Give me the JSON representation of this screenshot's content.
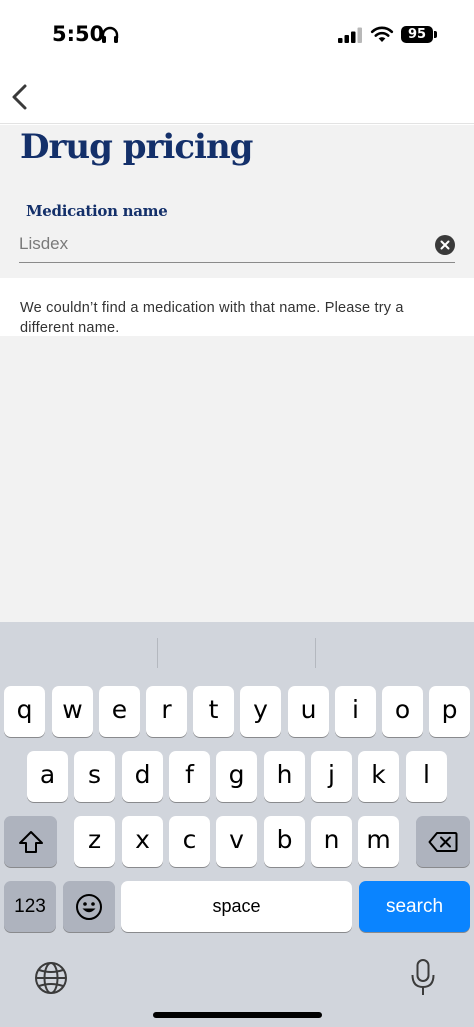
{
  "status_bar": {
    "time": "5:50",
    "battery": "95"
  },
  "nav": {
    "back_icon": "chevron-left-icon"
  },
  "page": {
    "title": "Drug pricing",
    "field_label": "Medication name",
    "field_value": "Lisdex",
    "clear_icon": "clear-icon",
    "message": "We couldn’t find a medication with that name. Please try a different name."
  },
  "keyboard": {
    "row1": [
      "q",
      "w",
      "e",
      "r",
      "t",
      "y",
      "u",
      "i",
      "o",
      "p"
    ],
    "row2": [
      "a",
      "s",
      "d",
      "f",
      "g",
      "h",
      "j",
      "k",
      "l"
    ],
    "row3": [
      "z",
      "x",
      "c",
      "v",
      "b",
      "n",
      "m"
    ],
    "numbers_label": "123",
    "space_label": "space",
    "search_label": "search",
    "accent_color": "#0a84ff"
  }
}
